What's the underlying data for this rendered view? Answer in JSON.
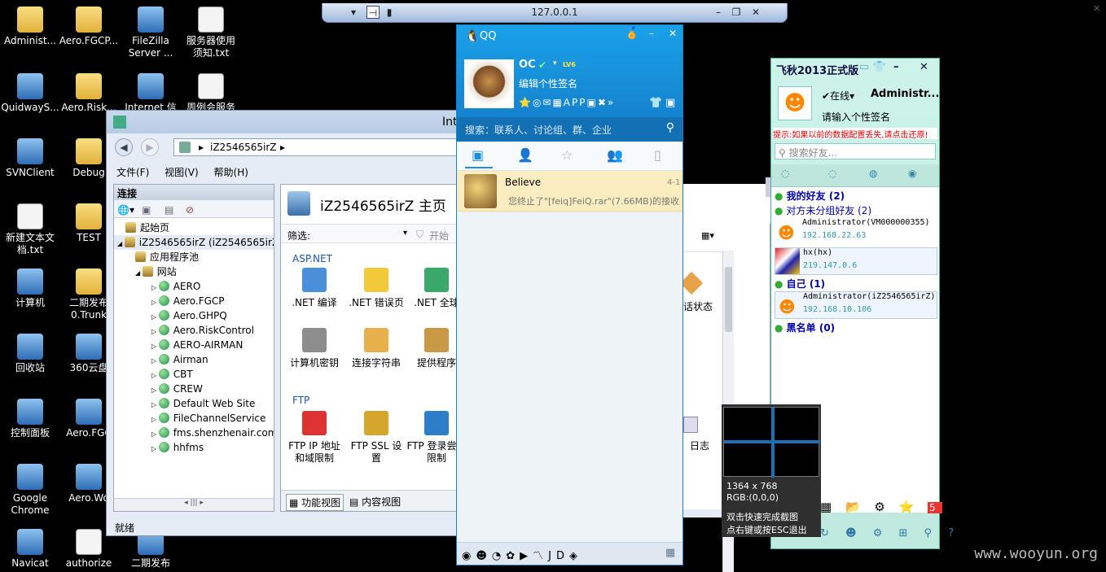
{
  "remote": {
    "title": "127.0.0.1"
  },
  "desktop": [
    {
      "label": "Administ...",
      "kind": "folder"
    },
    {
      "label": "Aero.FGCP...",
      "kind": "folder"
    },
    {
      "label": "FileZilla",
      "label2": "Server ...",
      "kind": "app"
    },
    {
      "label": "服务器使用",
      "label2": "须知.txt",
      "kind": "doc"
    },
    {
      "label": "QuidwayS...",
      "kind": "app"
    },
    {
      "label": "Aero.Risk...",
      "kind": "folder"
    },
    {
      "label": "Internet 信",
      "kind": "app"
    },
    {
      "label": "周例会服务",
      "kind": "doc"
    },
    {
      "label": "SVNClient",
      "kind": "app"
    },
    {
      "label": "Debug",
      "kind": "folder"
    },
    {
      "label": "新建文本文",
      "label2": "档.txt",
      "kind": "doc"
    },
    {
      "label": "TEST",
      "kind": "folder"
    },
    {
      "label": "计算机",
      "kind": "app"
    },
    {
      "label": "二期发布",
      "label2": "0.Trunk",
      "kind": "folder"
    },
    {
      "label": "回收站",
      "kind": "app"
    },
    {
      "label": "360云盘",
      "kind": "app"
    },
    {
      "label": "控制面板",
      "kind": "app"
    },
    {
      "label": "Aero.FGC",
      "kind": "app"
    },
    {
      "label": "Google",
      "label2": "Chrome",
      "kind": "app"
    },
    {
      "label": "Aero.Wo",
      "kind": "app"
    },
    {
      "label": "Navicat",
      "kind": "app"
    },
    {
      "label": "authorize",
      "kind": "doc"
    },
    {
      "label": "二期发布",
      "kind": "app"
    }
  ],
  "iis": {
    "title": "Int",
    "address": "iZ2546565irZ",
    "menu": [
      "文件(F)",
      "视图(V)",
      "帮助(H)"
    ],
    "connections_label": "连接",
    "tree": [
      "起始页",
      "iZ2546565irZ (iZ2546565irZ",
      "应用程序池",
      "网站",
      "AERO",
      "Aero.FGCP",
      "Aero.GHPQ",
      "Aero.RiskControl",
      "AERO-AIRMAN",
      "Airman",
      "CBT",
      "CREW",
      "Default Web Site",
      "FileChannelService",
      "fms.shenzhenair.com",
      "hhfms"
    ],
    "main_title": "iZ2546565irZ 主页",
    "filter_label": "筛选:",
    "start_label": "开始",
    "group_aspnet": "ASP.NET",
    "group_ftp": "FTP",
    "features": [
      ".NET 编译",
      ".NET 错误页",
      ".NET 全球",
      "计算机密钥",
      "连接字符串",
      "提供程序",
      "FTP IP 地址和域限制",
      "FTP SSL 设置",
      "FTP 登录尝试限制"
    ],
    "right_cut": [
      "话状态",
      "日志"
    ],
    "tab_features": "功能视图",
    "tab_content": "内容视图",
    "status": "就绪"
  },
  "qq": {
    "app": "QQ",
    "nick": "OC",
    "level": "LV6",
    "signature": "编辑个性签名",
    "search_placeholder": "搜索：联系人、讨论组、群、企业",
    "chat_name": "Believe",
    "chat_time": "4-1",
    "chat_msg": "您终止了\"[feiq]FeiQ.rar\"(7.66MB)的接收"
  },
  "feiq": {
    "title": "飞秋2013正式版",
    "status": "在线",
    "user": "Administr...",
    "sig": "请输入个性签名",
    "notice": "提示:如果以前的数据配置丢失,请点击还原!",
    "search": "搜索好友...",
    "groups": {
      "friends": "我的好友 (2)",
      "ungrouped": "对方未分组好友 (2)",
      "self": "自己 (1)",
      "blacklist": "黑名单 (0)"
    },
    "contacts": [
      {
        "name": "Administrator(VM000000355)",
        "ip": "192.168.22.63"
      },
      {
        "name": "hx(hx)",
        "ip": "219.147.0.6"
      },
      {
        "name": "Administrator(iZ2546565irZ)",
        "ip": "192.168.10.106"
      }
    ]
  },
  "snap": {
    "size": "1364 x 768",
    "rgb": "RGB:(0,0,0)",
    "hint1": "双击快速完成截图",
    "hint2": "点右键或按ESC退出"
  },
  "watermark": "www.wooyun.org"
}
